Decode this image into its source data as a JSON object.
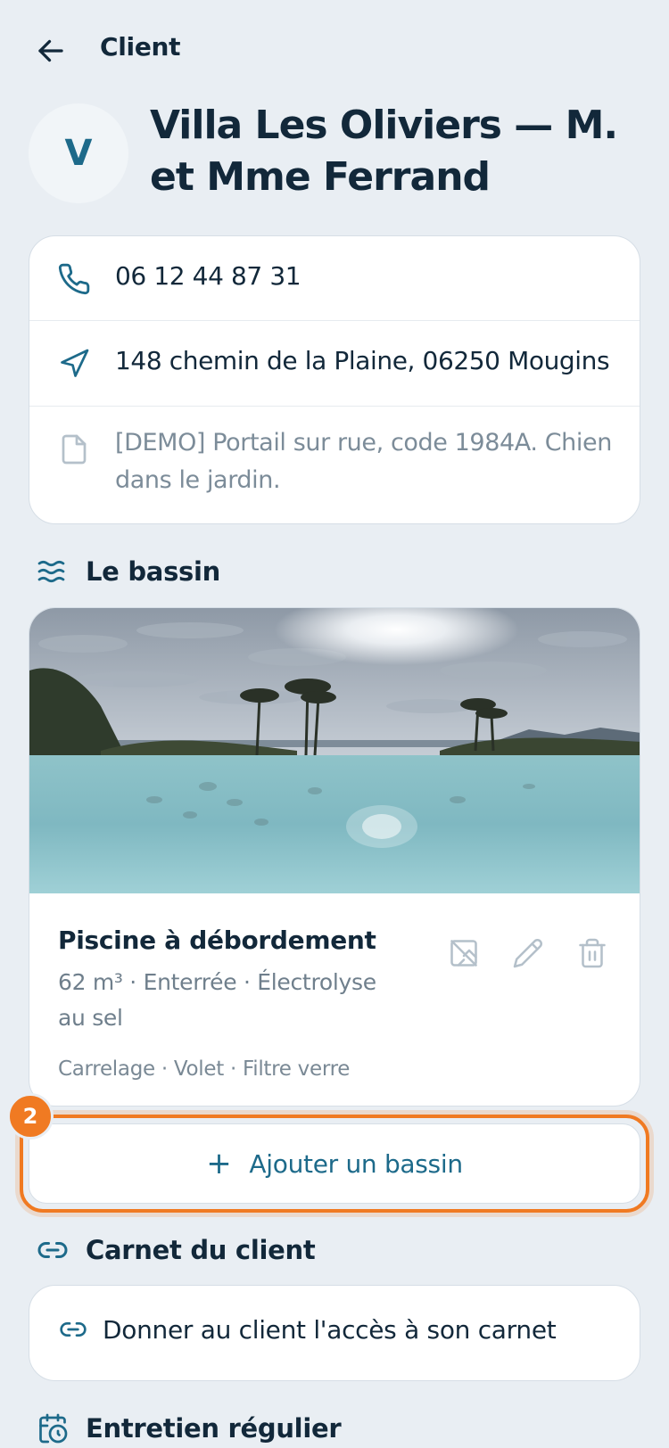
{
  "topbar": {
    "back_icon": "arrow-left-icon",
    "title": "Client"
  },
  "client": {
    "avatar_letter": "V",
    "name": "Villa Les Oliviers — M. et Mme Ferrand",
    "phone": "06 12 44 87 31",
    "address": "148 chemin de la Plaine, 06250 Mougins",
    "note": "[DEMO] Portail sur rue, code 1984A. Chien dans le jardin."
  },
  "sections": {
    "bassin": "Le bassin",
    "carnet": "Carnet du client",
    "entretien": "Entretien régulier"
  },
  "pool": {
    "name": "Piscine à débordement",
    "specs": "62 m³ · Enterrée · Électrolyse au sel",
    "options": "Carrelage · Volet · Filtre verre",
    "actions": [
      "remove-photo-icon",
      "pencil-icon",
      "trash-icon"
    ]
  },
  "add_pool": {
    "label": "Ajouter un bassin",
    "step_badge": "2"
  },
  "share": {
    "label": "Donner au client l'accès à son carnet"
  },
  "colors": {
    "accent": "#1d6a8a",
    "highlight": "#f07a22",
    "background": "#e9eef3"
  }
}
